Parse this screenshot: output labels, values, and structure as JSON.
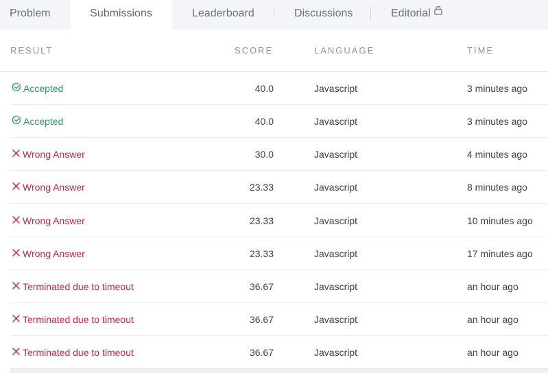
{
  "tabs": [
    {
      "label": "Problem",
      "active": false
    },
    {
      "label": "Submissions",
      "active": true
    },
    {
      "label": "Leaderboard",
      "active": false
    },
    {
      "label": "Discussions",
      "active": false
    },
    {
      "label": "Editorial",
      "active": false,
      "icon": "lock-icon"
    }
  ],
  "table": {
    "headers": {
      "result": "RESULT",
      "score": "SCORE",
      "language": "LANGUAGE",
      "time": "TIME"
    },
    "rows": [
      {
        "status": "accepted",
        "result": "Accepted",
        "score": "40.0",
        "language": "Javascript",
        "time": "3 minutes ago"
      },
      {
        "status": "accepted",
        "result": "Accepted",
        "score": "40.0",
        "language": "Javascript",
        "time": "3 minutes ago"
      },
      {
        "status": "failed",
        "result": "Wrong Answer",
        "score": "30.0",
        "language": "Javascript",
        "time": "4 minutes ago"
      },
      {
        "status": "failed",
        "result": "Wrong Answer",
        "score": "23.33",
        "language": "Javascript",
        "time": "8 minutes ago"
      },
      {
        "status": "failed",
        "result": "Wrong Answer",
        "score": "23.33",
        "language": "Javascript",
        "time": "10 minutes ago"
      },
      {
        "status": "failed",
        "result": "Wrong Answer",
        "score": "23.33",
        "language": "Javascript",
        "time": "17 minutes ago"
      },
      {
        "status": "failed",
        "result": "Terminated due to timeout",
        "score": "36.67",
        "language": "Javascript",
        "time": "an hour ago"
      },
      {
        "status": "failed",
        "result": "Terminated due to timeout",
        "score": "36.67",
        "language": "Javascript",
        "time": "an hour ago"
      },
      {
        "status": "failed",
        "result": "Terminated due to timeout",
        "score": "36.67",
        "language": "Javascript",
        "time": "an hour ago"
      }
    ]
  },
  "colors": {
    "accepted": "#2a9d56",
    "failed": "#c7254e",
    "tab_bar": "#f3f5f8",
    "header_text": "#8a949e"
  },
  "icons": {
    "accepted": "check-circle-icon",
    "failed": "cross-icon"
  }
}
